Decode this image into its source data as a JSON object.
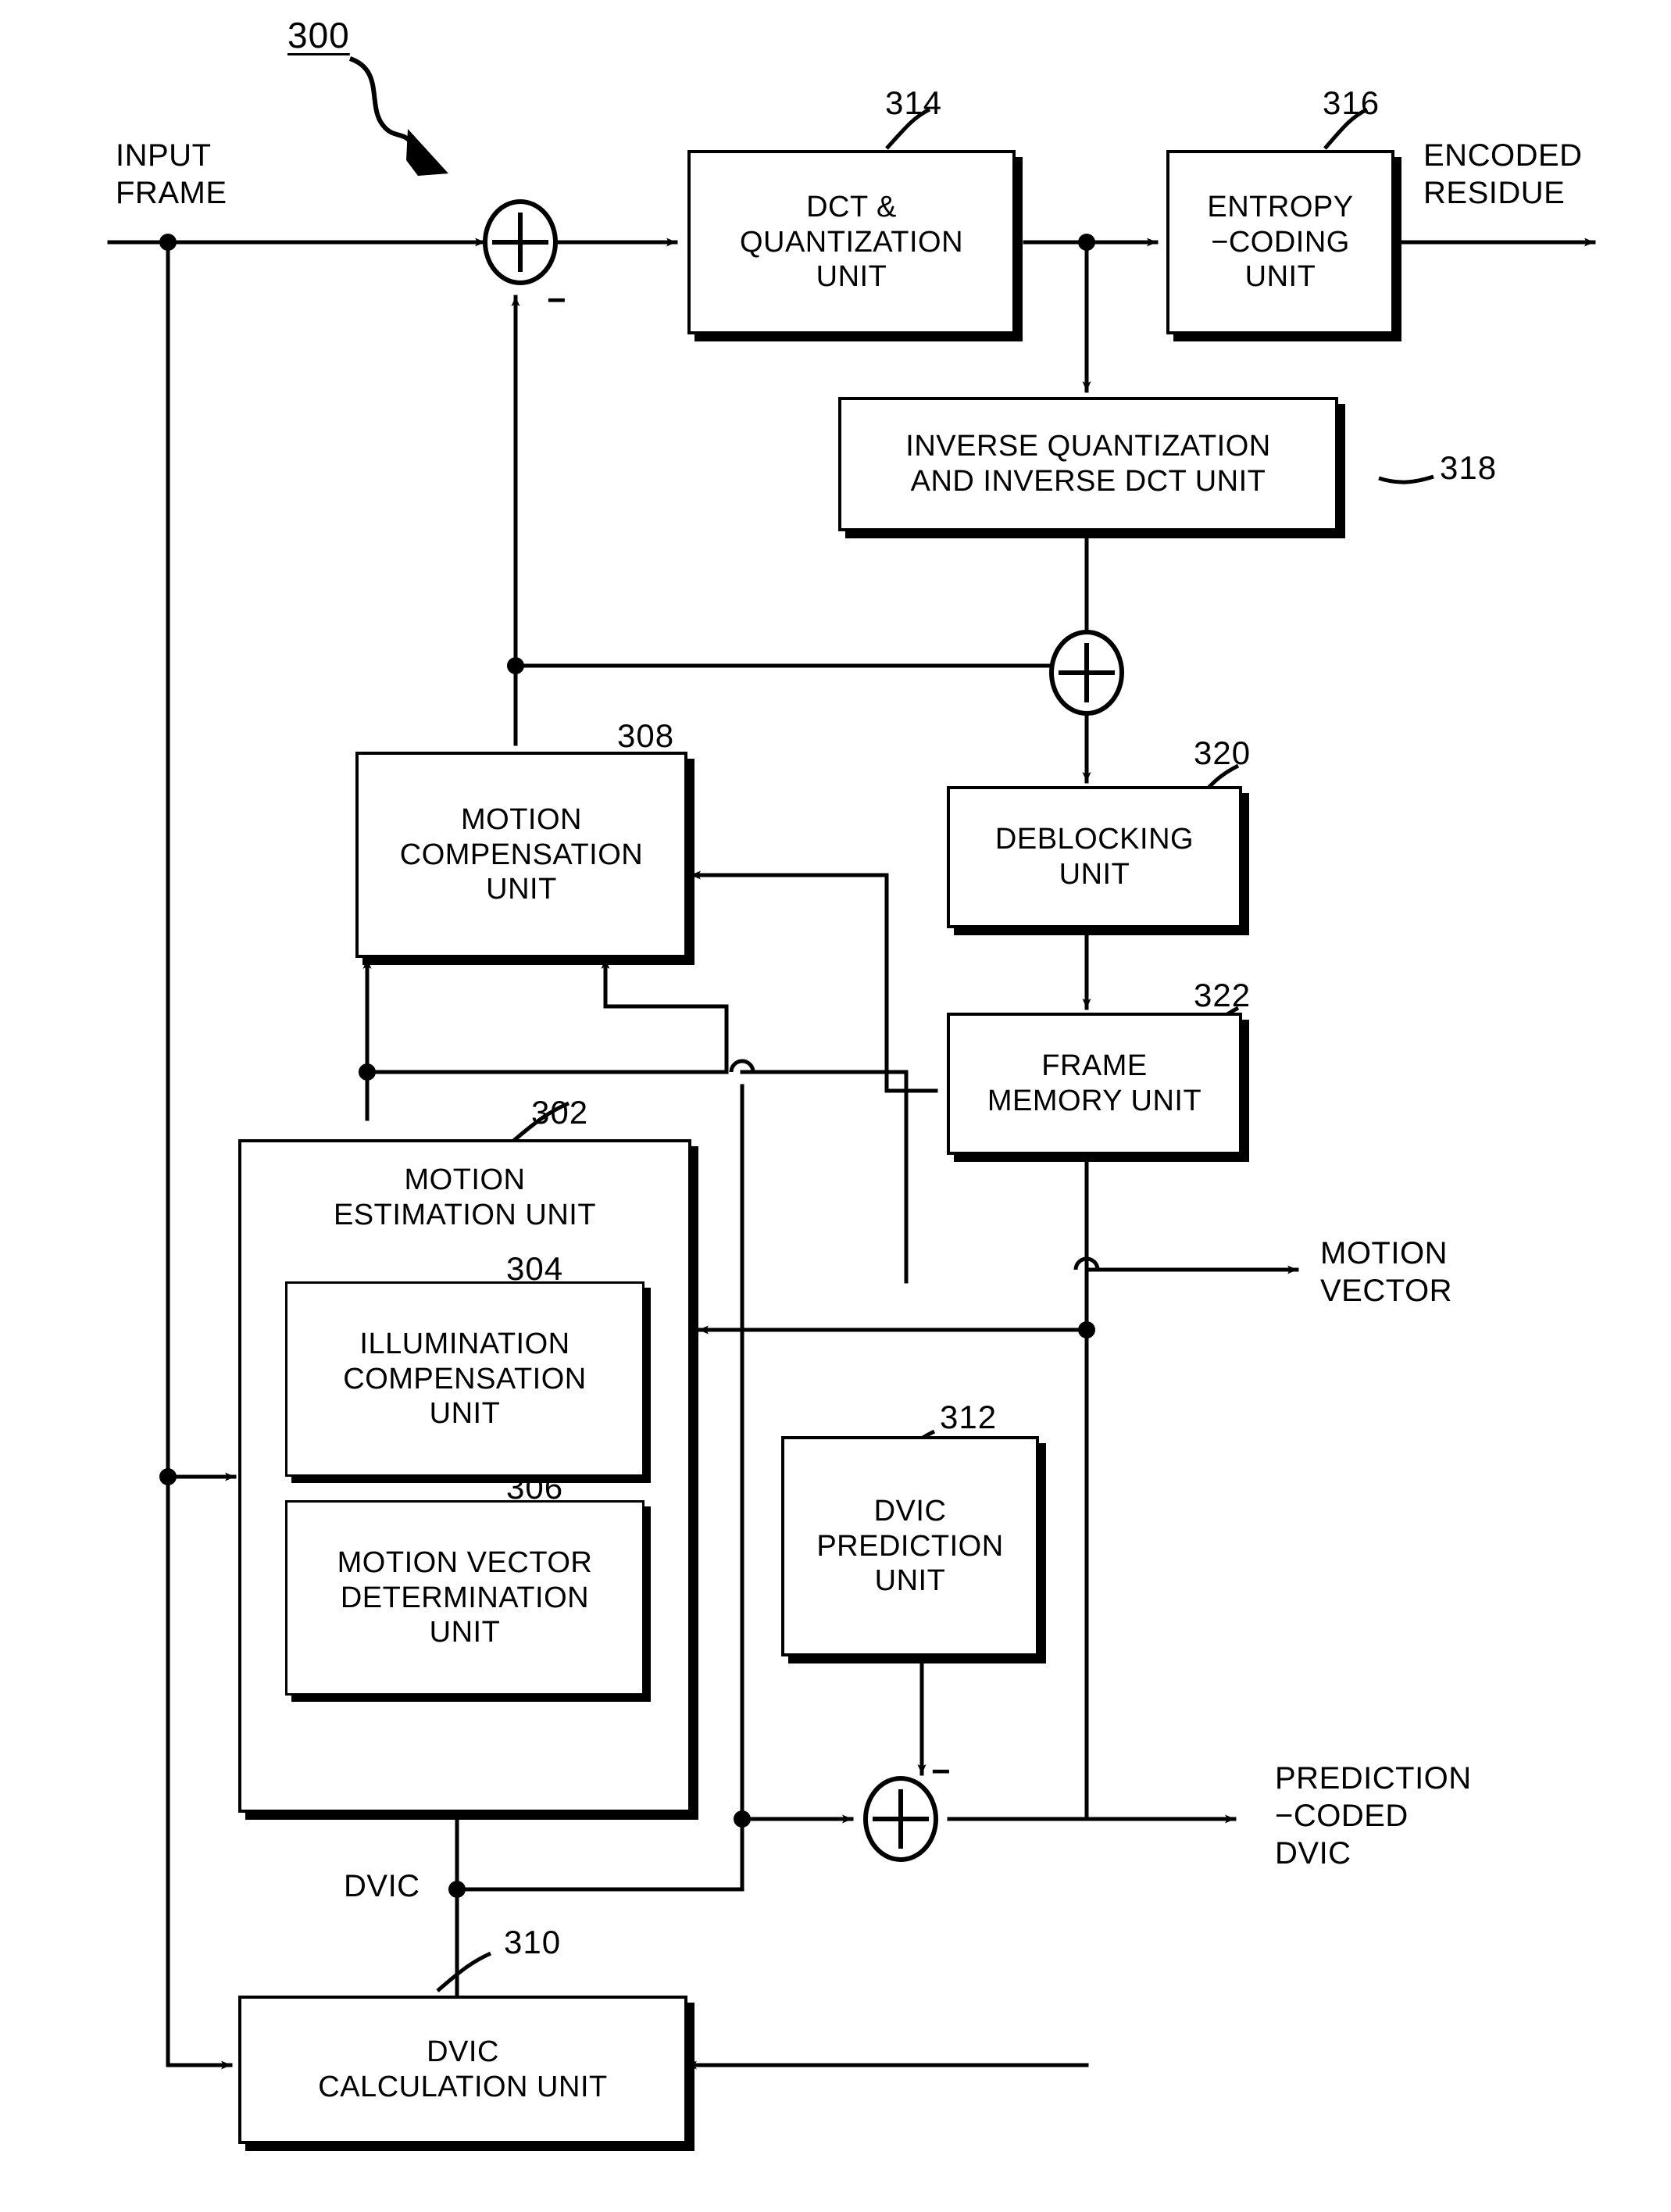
{
  "figure": {
    "number": "300",
    "type": "video-encoder-block-diagram"
  },
  "io_labels": {
    "input_frame": "INPUT\nFRAME",
    "encoded_residue": "ENCODED\nRESIDUE",
    "motion_vector": "MOTION\nVECTOR",
    "prediction_coded_dvic": "PREDICTION\n−CODED\nDVIC",
    "dvic": "DVIC"
  },
  "blocks": [
    {
      "id": "302",
      "ref": "302",
      "label": "MOTION\nESTIMATION UNIT"
    },
    {
      "id": "304",
      "ref": "304",
      "label": "ILLUMINATION\nCOMPENSATION\nUNIT"
    },
    {
      "id": "306",
      "ref": "306",
      "label": "MOTION VECTOR\nDETERMINATION\nUNIT"
    },
    {
      "id": "308",
      "ref": "308",
      "label": "MOTION\nCOMPENSATION\nUNIT"
    },
    {
      "id": "310",
      "ref": "310",
      "label": "DVIC\nCALCULATION UNIT"
    },
    {
      "id": "312",
      "ref": "312",
      "label": "DVIC\nPREDICTION\nUNIT"
    },
    {
      "id": "314",
      "ref": "314",
      "label": "DCT &\nQUANTIZATION\nUNIT"
    },
    {
      "id": "316",
      "ref": "316",
      "label": "ENTROPY\n−CODING\nUNIT"
    },
    {
      "id": "318",
      "ref": "318",
      "label": "INVERSE QUANTIZATION\nAND INVERSE DCT UNIT"
    },
    {
      "id": "320",
      "ref": "320",
      "label": "DEBLOCKING\nUNIT"
    },
    {
      "id": "322",
      "ref": "322",
      "label": "FRAME\nMEMORY UNIT"
    }
  ],
  "junctions": {
    "subtract_sign_top": "−",
    "subtract_sign_bottom": "−"
  },
  "colors": {
    "ink": "#000000",
    "paper": "#ffffff"
  }
}
